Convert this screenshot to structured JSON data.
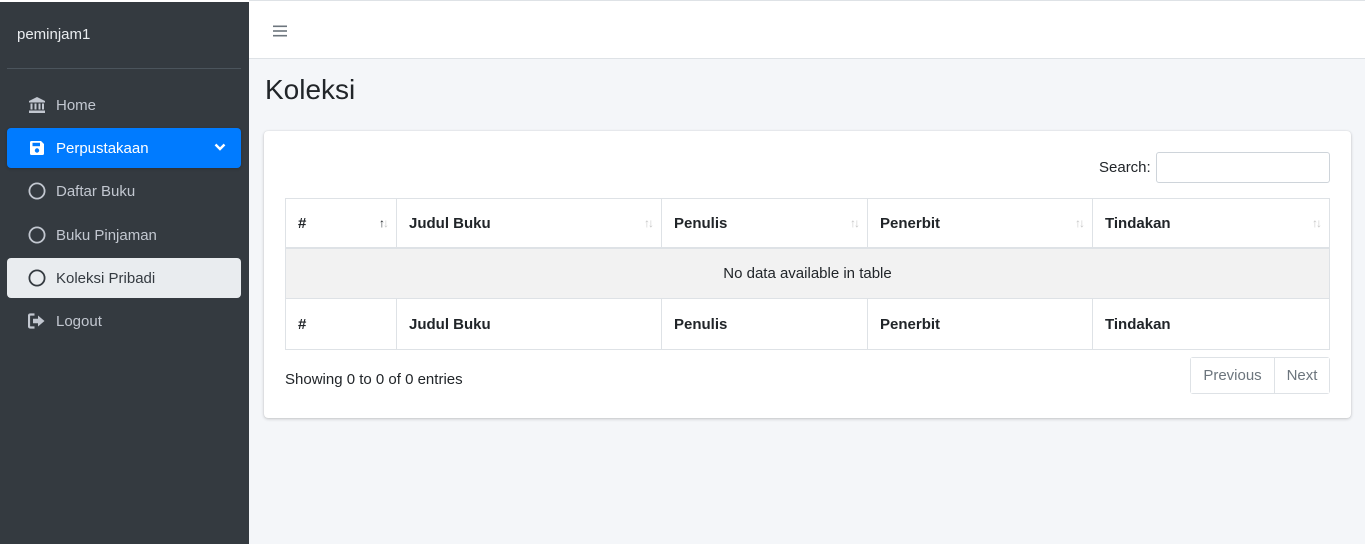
{
  "sidebar": {
    "brand": "peminjam1",
    "items": [
      {
        "label": "Home",
        "icon": "landmark-icon"
      },
      {
        "label": "Perpustakaan",
        "icon": "save-icon",
        "active": true
      },
      {
        "label": "Daftar Buku",
        "icon": "circle-icon"
      },
      {
        "label": "Buku Pinjaman",
        "icon": "circle-icon"
      },
      {
        "label": "Koleksi Pribadi",
        "icon": "circle-icon",
        "current": true
      },
      {
        "label": "Logout",
        "icon": "sign-out-icon"
      }
    ]
  },
  "header": {
    "menu_icon": "hamburger-icon"
  },
  "page": {
    "title": "Koleksi"
  },
  "table": {
    "search_label": "Search:",
    "search_value": "",
    "columns": [
      "#",
      "Judul Buku",
      "Penulis",
      "Penerbit",
      "Tindakan"
    ],
    "empty_message": "No data available in table",
    "info": "Showing 0 to 0 of 0 entries",
    "pagination": {
      "previous": "Previous",
      "next": "Next"
    }
  },
  "colors": {
    "sidebar_bg": "#343a40",
    "accent": "#007bff",
    "content_bg": "#f4f6f9"
  }
}
